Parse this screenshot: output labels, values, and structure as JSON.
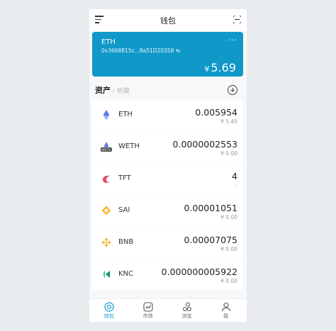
{
  "header": {
    "title": "钱包"
  },
  "wallet": {
    "name": "ETH",
    "address": "0x3668815c...8a51D20358",
    "balance_currency": "¥",
    "balance_value": "5.69",
    "more_label": "···"
  },
  "assets": {
    "tab_active": "资产",
    "tab_sep": "/",
    "tab_inactive": "收藏"
  },
  "asset_rows": [
    {
      "symbol": "ETH",
      "amount": "0.005954",
      "fiat": "¥ 5.45",
      "icon": "eth-icon"
    },
    {
      "symbol": "WETH",
      "amount": "0.0000002553",
      "fiat": "¥ 0.00",
      "icon": "weth-icon"
    },
    {
      "symbol": "TFT",
      "amount": "4",
      "fiat": "–",
      "icon": "tft-icon"
    },
    {
      "symbol": "SAI",
      "amount": "0.00001051",
      "fiat": "¥ 0.00",
      "icon": "sai-icon"
    },
    {
      "symbol": "BNB",
      "amount": "0.00007075",
      "fiat": "¥ 0.00",
      "icon": "bnb-icon"
    },
    {
      "symbol": "KNC",
      "amount": "0.000000005922",
      "fiat": "¥ 0.00",
      "icon": "knc-icon"
    }
  ],
  "tabbar": [
    {
      "label": "钱包",
      "icon": "wallet-icon",
      "active": true
    },
    {
      "label": "市场",
      "icon": "market-icon",
      "active": false
    },
    {
      "label": "浏览",
      "icon": "browse-icon",
      "active": false
    },
    {
      "label": "我",
      "icon": "profile-icon",
      "active": false
    }
  ],
  "colors": {
    "accent": "#1098c9",
    "background": "#f7f8fa"
  }
}
